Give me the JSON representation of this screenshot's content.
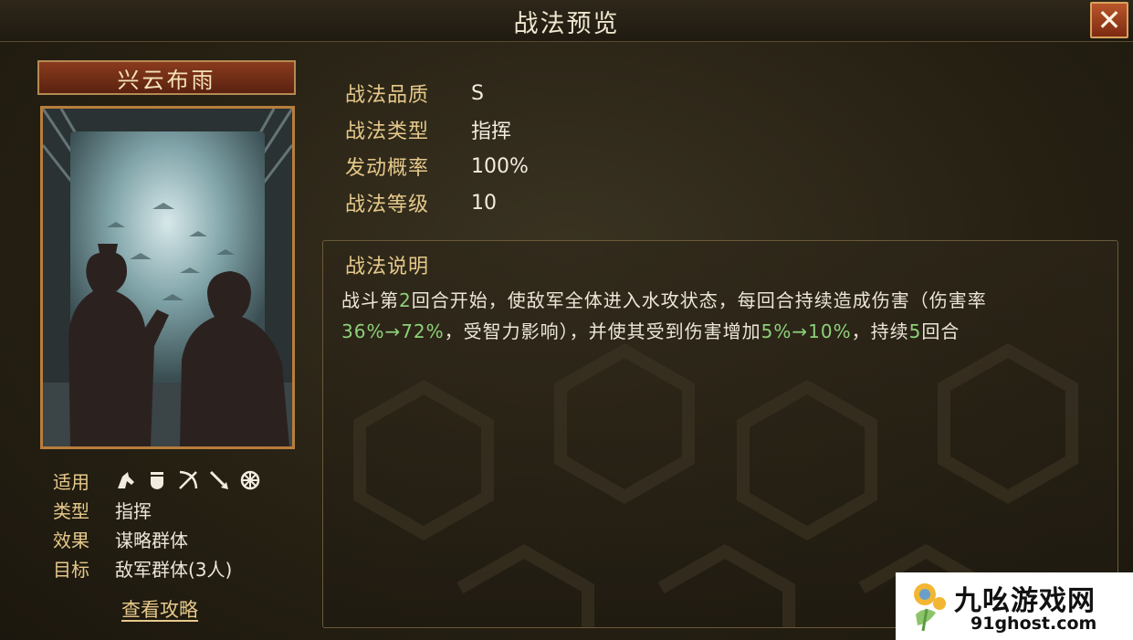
{
  "window": {
    "title": "战法预览",
    "close_label": "✕"
  },
  "skill": {
    "name": "兴云布雨",
    "info": {
      "apply_label": "适用",
      "apply_icons": [
        "cavalry-icon",
        "shield-icon",
        "bow-icon",
        "spear-icon",
        "wheel-icon"
      ],
      "type_label": "类型",
      "type_value": "指挥",
      "effect_label": "效果",
      "effect_value": "谋略群体",
      "target_label": "目标",
      "target_value": "敌军群体(3人)"
    },
    "guide_link": "查看攻略"
  },
  "stats": [
    {
      "key": "战法品质",
      "value": "S"
    },
    {
      "key": "战法类型",
      "value": "指挥"
    },
    {
      "key": "发动概率",
      "value": "100%"
    },
    {
      "key": "战法等级",
      "value": "10"
    }
  ],
  "description": {
    "title": "战法说明",
    "segments": [
      {
        "text": "战斗第",
        "hl": false
      },
      {
        "text": "2",
        "hl": true
      },
      {
        "text": "回合开始，使敌军全体进入水攻状态，每回合持续造成伤害（伤害率",
        "hl": false
      },
      {
        "text": "36%→72%",
        "hl": true
      },
      {
        "text": "，受智力影响），并使其受到伤害增加",
        "hl": false
      },
      {
        "text": "5%→10%",
        "hl": true
      },
      {
        "text": "，持续",
        "hl": false
      },
      {
        "text": "5",
        "hl": true
      },
      {
        "text": "回合",
        "hl": false
      }
    ]
  },
  "watermark": {
    "title": "九吆游戏网",
    "url": "91ghost.com"
  },
  "colors": {
    "gold": "#e6c98a",
    "highlight": "#8ed07a",
    "close_bg": "#a4431f"
  }
}
